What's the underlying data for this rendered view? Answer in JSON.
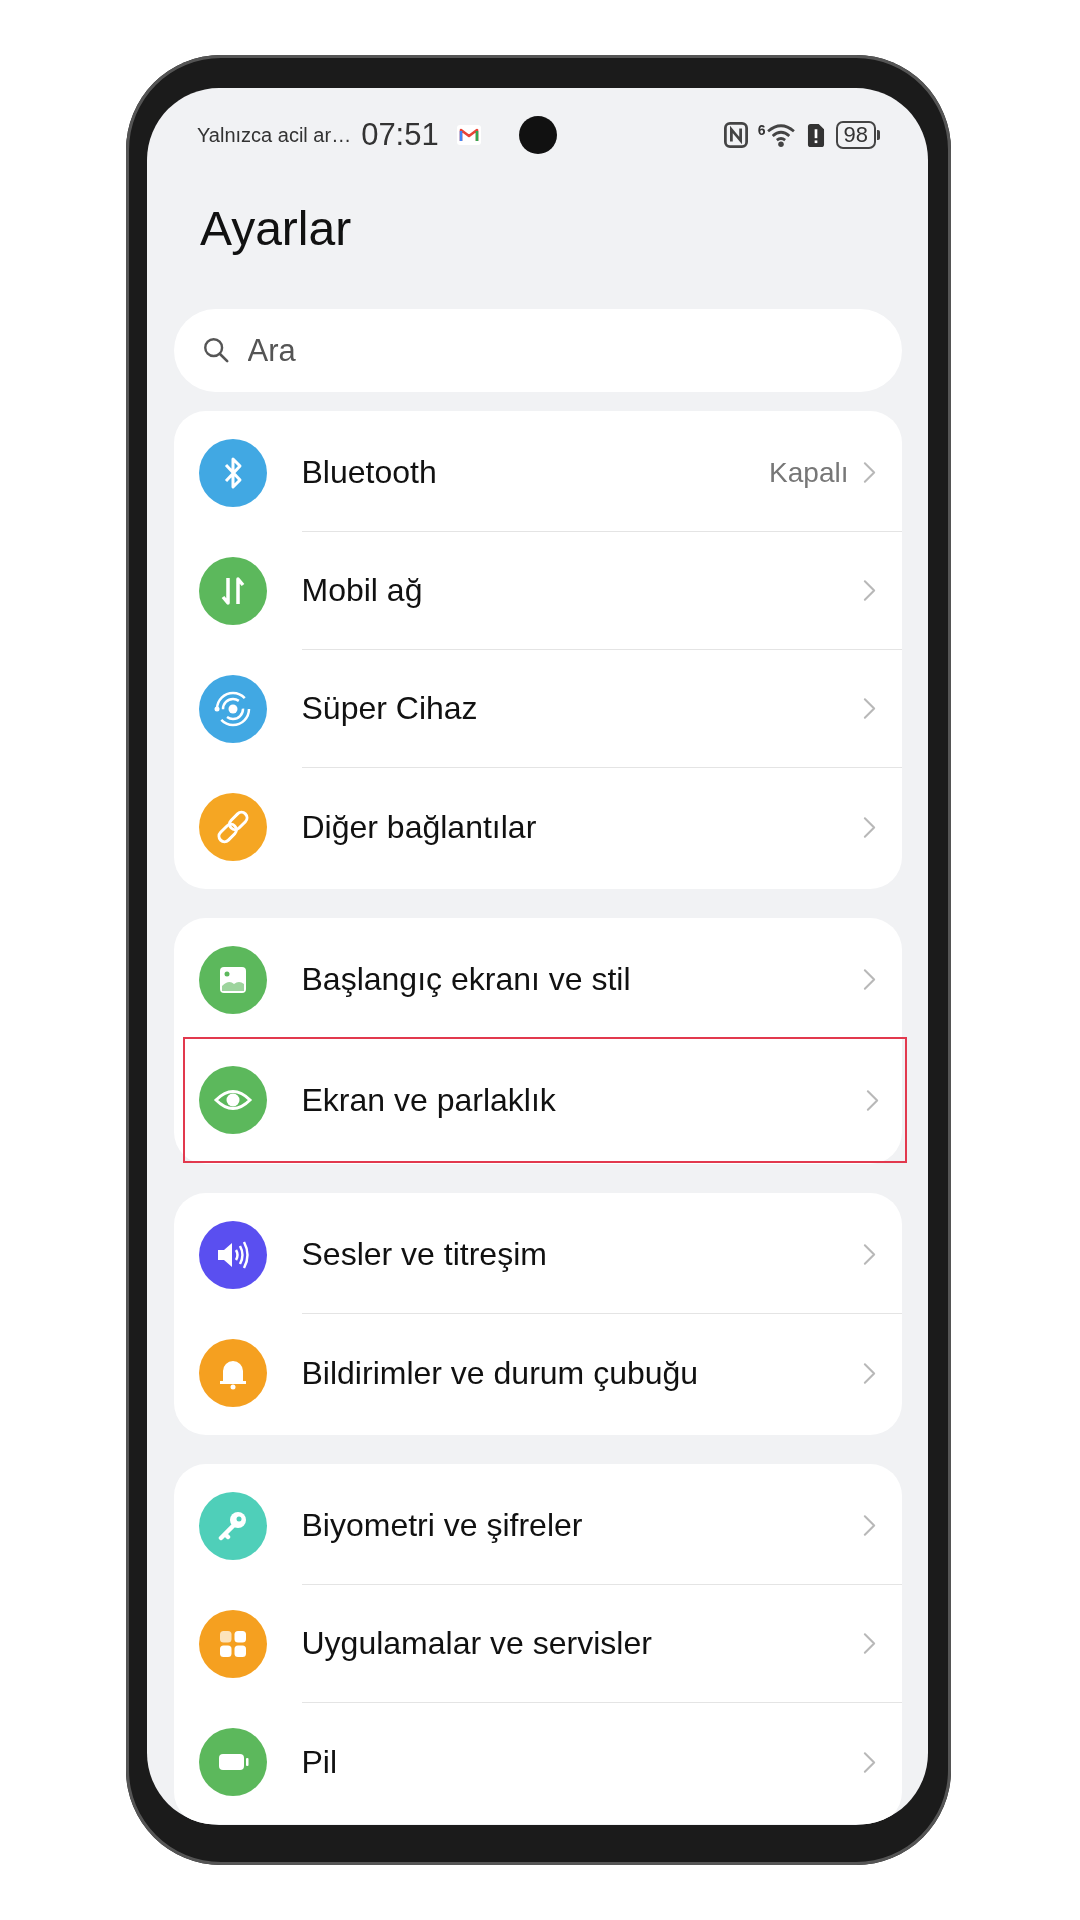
{
  "status_bar": {
    "notice": "Yalnızca acil ar…",
    "time": "07:51",
    "wifi_badge": "6",
    "battery": "98"
  },
  "title": "Ayarlar",
  "search": {
    "placeholder": "Ara"
  },
  "groups": [
    {
      "items": [
        {
          "label": "Bluetooth",
          "value": "Kapalı",
          "color": "#41a8e3",
          "highlighted": false
        },
        {
          "label": "Mobil ağ",
          "color": "#5cb85c",
          "highlighted": false
        },
        {
          "label": "Süper Cihaz",
          "color": "#41a8e3",
          "highlighted": false
        },
        {
          "label": "Diğer bağlantılar",
          "color": "#f5a623",
          "highlighted": false
        }
      ]
    },
    {
      "items": [
        {
          "label": "Başlangıç ekranı ve stil",
          "color": "#5cb85c",
          "highlighted": false
        },
        {
          "label": "Ekran ve parlaklık",
          "color": "#5cb85c",
          "highlighted": true
        }
      ]
    },
    {
      "items": [
        {
          "label": "Sesler ve titreşim",
          "color": "#5a4ff0",
          "highlighted": false
        },
        {
          "label": "Bildirimler ve durum çubuğu",
          "color": "#f5a020",
          "highlighted": false
        }
      ]
    },
    {
      "items": [
        {
          "label": "Biyometri ve şifreler",
          "color": "#4fcfb9",
          "highlighted": false
        },
        {
          "label": "Uygulamalar ve servisler",
          "color": "#f5a020",
          "highlighted": false
        },
        {
          "label": "Pil",
          "color": "#5cb85c",
          "highlighted": false
        }
      ]
    }
  ]
}
